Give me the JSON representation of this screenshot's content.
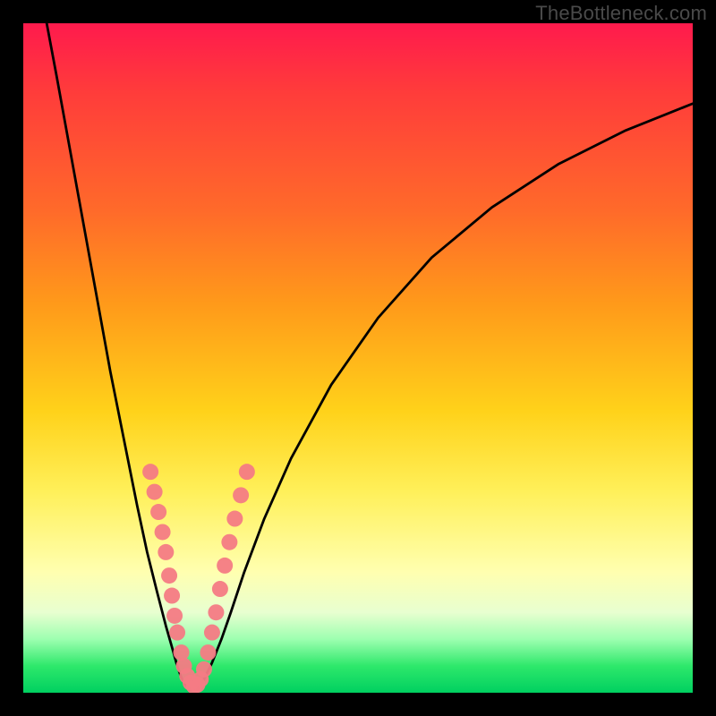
{
  "watermark": "TheBottleneck.com",
  "chart_data": {
    "type": "line",
    "title": "",
    "xlabel": "",
    "ylabel": "",
    "xlim": [
      0,
      100
    ],
    "ylim": [
      0,
      100
    ],
    "gradient_stops": [
      {
        "pos": 0,
        "color": "#ff1a4d"
      },
      {
        "pos": 10,
        "color": "#ff3b3b"
      },
      {
        "pos": 28,
        "color": "#ff6a2a"
      },
      {
        "pos": 42,
        "color": "#ff9a1a"
      },
      {
        "pos": 58,
        "color": "#ffd21a"
      },
      {
        "pos": 70,
        "color": "#fff05a"
      },
      {
        "pos": 82,
        "color": "#ffffb0"
      },
      {
        "pos": 88,
        "color": "#e8ffd0"
      },
      {
        "pos": 92,
        "color": "#9dffb0"
      },
      {
        "pos": 96,
        "color": "#2ee86b"
      },
      {
        "pos": 100,
        "color": "#00d060"
      }
    ],
    "series": [
      {
        "name": "left-curve",
        "x": [
          3.5,
          5.0,
          7.0,
          9.0,
          11.0,
          13.0,
          15.0,
          17.0,
          18.5,
          20.0,
          21.3,
          22.3,
          23.0,
          23.6,
          24.2,
          25.0
        ],
        "y": [
          100,
          92,
          81,
          70,
          59,
          48,
          38,
          28,
          21,
          15,
          10,
          6.5,
          4.0,
          2.3,
          1.2,
          0.4
        ]
      },
      {
        "name": "right-curve",
        "x": [
          26.0,
          27.0,
          28.2,
          29.6,
          31.0,
          33.0,
          36.0,
          40.0,
          46.0,
          53.0,
          61.0,
          70.0,
          80.0,
          90.0,
          100.0
        ],
        "y": [
          0.4,
          2.0,
          4.5,
          8.0,
          12.0,
          18.0,
          26.0,
          35.0,
          46.0,
          56.0,
          65.0,
          72.5,
          79.0,
          84.0,
          88.0
        ]
      }
    ],
    "markers": {
      "name": "highlight-dots",
      "color": "#f47b84",
      "points": [
        {
          "x": 19.0,
          "y": 33.0
        },
        {
          "x": 19.6,
          "y": 30.0
        },
        {
          "x": 20.2,
          "y": 27.0
        },
        {
          "x": 20.8,
          "y": 24.0
        },
        {
          "x": 21.3,
          "y": 21.0
        },
        {
          "x": 21.8,
          "y": 17.5
        },
        {
          "x": 22.2,
          "y": 14.5
        },
        {
          "x": 22.6,
          "y": 11.5
        },
        {
          "x": 23.0,
          "y": 9.0
        },
        {
          "x": 23.6,
          "y": 6.0
        },
        {
          "x": 24.0,
          "y": 4.0
        },
        {
          "x": 24.5,
          "y": 2.5
        },
        {
          "x": 25.0,
          "y": 1.5
        },
        {
          "x": 25.5,
          "y": 1.0
        },
        {
          "x": 26.0,
          "y": 1.2
        },
        {
          "x": 26.5,
          "y": 2.0
        },
        {
          "x": 27.0,
          "y": 3.5
        },
        {
          "x": 27.6,
          "y": 6.0
        },
        {
          "x": 28.2,
          "y": 9.0
        },
        {
          "x": 28.8,
          "y": 12.0
        },
        {
          "x": 29.4,
          "y": 15.5
        },
        {
          "x": 30.1,
          "y": 19.0
        },
        {
          "x": 30.8,
          "y": 22.5
        },
        {
          "x": 31.6,
          "y": 26.0
        },
        {
          "x": 32.5,
          "y": 29.5
        },
        {
          "x": 33.4,
          "y": 33.0
        }
      ]
    },
    "minimum": {
      "x": 25.5,
      "y": 0.4
    }
  }
}
